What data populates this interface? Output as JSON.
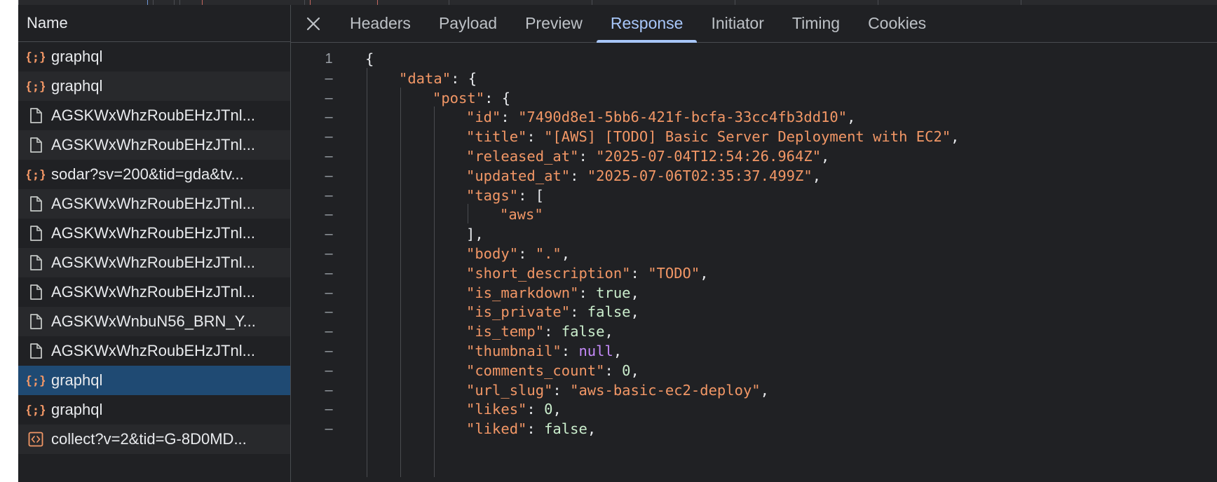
{
  "requests_panel": {
    "header": "Name",
    "rows": [
      {
        "name": "graphql",
        "icon": "json-icon"
      },
      {
        "name": "graphql",
        "icon": "json-icon"
      },
      {
        "name": "AGSKWxWhzRoubEHzJTnl...",
        "icon": "document-icon"
      },
      {
        "name": "AGSKWxWhzRoubEHzJTnl...",
        "icon": "document-icon"
      },
      {
        "name": "sodar?sv=200&tid=gda&tv...",
        "icon": "json-icon"
      },
      {
        "name": "AGSKWxWhzRoubEHzJTnl...",
        "icon": "document-icon"
      },
      {
        "name": "AGSKWxWhzRoubEHzJTnl...",
        "icon": "document-icon"
      },
      {
        "name": "AGSKWxWhzRoubEHzJTnl...",
        "icon": "document-icon"
      },
      {
        "name": "AGSKWxWhzRoubEHzJTnl...",
        "icon": "document-icon"
      },
      {
        "name": "AGSKWxWnbuN56_BRN_Y...",
        "icon": "document-icon"
      },
      {
        "name": "AGSKWxWhzRoubEHzJTnl...",
        "icon": "document-icon"
      },
      {
        "name": "graphql",
        "icon": "json-icon",
        "selected": true
      },
      {
        "name": "graphql",
        "icon": "json-icon"
      },
      {
        "name": "collect?v=2&tid=G-8D0MD...",
        "icon": "script-icon"
      }
    ]
  },
  "tabs": [
    "Headers",
    "Payload",
    "Preview",
    "Response",
    "Initiator",
    "Timing",
    "Cookies"
  ],
  "active_tab": "Response",
  "response": {
    "first_line_number": "1",
    "fold_marker": "–",
    "lines": [
      {
        "indent": 0,
        "parts": [
          [
            "p",
            "{"
          ]
        ]
      },
      {
        "indent": 1,
        "parts": [
          [
            "k",
            "\"data\""
          ],
          [
            "p",
            ": {"
          ]
        ]
      },
      {
        "indent": 2,
        "parts": [
          [
            "k",
            "\"post\""
          ],
          [
            "p",
            ": {"
          ]
        ]
      },
      {
        "indent": 3,
        "parts": [
          [
            "k",
            "\"id\""
          ],
          [
            "p",
            ": "
          ],
          [
            "s",
            "\"7490d8e1-5bb6-421f-bcfa-33cc4fb3dd10\""
          ],
          [
            "p",
            ","
          ]
        ]
      },
      {
        "indent": 3,
        "parts": [
          [
            "k",
            "\"title\""
          ],
          [
            "p",
            ": "
          ],
          [
            "s",
            "\"[AWS] [TODO] Basic Server Deployment with EC2\""
          ],
          [
            "p",
            ","
          ]
        ]
      },
      {
        "indent": 3,
        "parts": [
          [
            "k",
            "\"released_at\""
          ],
          [
            "p",
            ": "
          ],
          [
            "s",
            "\"2025-07-04T12:54:26.964Z\""
          ],
          [
            "p",
            ","
          ]
        ]
      },
      {
        "indent": 3,
        "parts": [
          [
            "k",
            "\"updated_at\""
          ],
          [
            "p",
            ": "
          ],
          [
            "s",
            "\"2025-07-06T02:35:37.499Z\""
          ],
          [
            "p",
            ","
          ]
        ]
      },
      {
        "indent": 3,
        "parts": [
          [
            "k",
            "\"tags\""
          ],
          [
            "p",
            ": ["
          ]
        ]
      },
      {
        "indent": 4,
        "parts": [
          [
            "s",
            "\"aws\""
          ]
        ]
      },
      {
        "indent": 3,
        "parts": [
          [
            "p",
            "],"
          ]
        ]
      },
      {
        "indent": 3,
        "parts": [
          [
            "k",
            "\"body\""
          ],
          [
            "p",
            ": "
          ],
          [
            "s",
            "\".\""
          ],
          [
            "p",
            ","
          ]
        ]
      },
      {
        "indent": 3,
        "parts": [
          [
            "k",
            "\"short_description\""
          ],
          [
            "p",
            ": "
          ],
          [
            "s",
            "\"TODO\""
          ],
          [
            "p",
            ","
          ]
        ]
      },
      {
        "indent": 3,
        "parts": [
          [
            "k",
            "\"is_markdown\""
          ],
          [
            "p",
            ": "
          ],
          [
            "b",
            "true"
          ],
          [
            "p",
            ","
          ]
        ]
      },
      {
        "indent": 3,
        "parts": [
          [
            "k",
            "\"is_private\""
          ],
          [
            "p",
            ": "
          ],
          [
            "b",
            "false"
          ],
          [
            "p",
            ","
          ]
        ]
      },
      {
        "indent": 3,
        "parts": [
          [
            "k",
            "\"is_temp\""
          ],
          [
            "p",
            ": "
          ],
          [
            "b",
            "false"
          ],
          [
            "p",
            ","
          ]
        ]
      },
      {
        "indent": 3,
        "parts": [
          [
            "k",
            "\"thumbnail\""
          ],
          [
            "p",
            ": "
          ],
          [
            "nl",
            "null"
          ],
          [
            "p",
            ","
          ]
        ]
      },
      {
        "indent": 3,
        "parts": [
          [
            "k",
            "\"comments_count\""
          ],
          [
            "p",
            ": "
          ],
          [
            "n",
            "0"
          ],
          [
            "p",
            ","
          ]
        ]
      },
      {
        "indent": 3,
        "parts": [
          [
            "k",
            "\"url_slug\""
          ],
          [
            "p",
            ": "
          ],
          [
            "s",
            "\"aws-basic-ec2-deploy\""
          ],
          [
            "p",
            ","
          ]
        ]
      },
      {
        "indent": 3,
        "parts": [
          [
            "k",
            "\"likes\""
          ],
          [
            "p",
            ": "
          ],
          [
            "n",
            "0"
          ],
          [
            "p",
            ","
          ]
        ]
      },
      {
        "indent": 3,
        "parts": [
          [
            "k",
            "\"liked\""
          ],
          [
            "p",
            ": "
          ],
          [
            "b",
            "false"
          ],
          [
            "p",
            ","
          ]
        ]
      }
    ]
  },
  "colors": {
    "background": "#202124",
    "selected_row": "#1f4a73",
    "active_tab": "#a8c7fa",
    "json_key": "#f29766",
    "json_string": "#f29766",
    "json_literal": "#cbeecd",
    "json_null": "#c58af9"
  }
}
